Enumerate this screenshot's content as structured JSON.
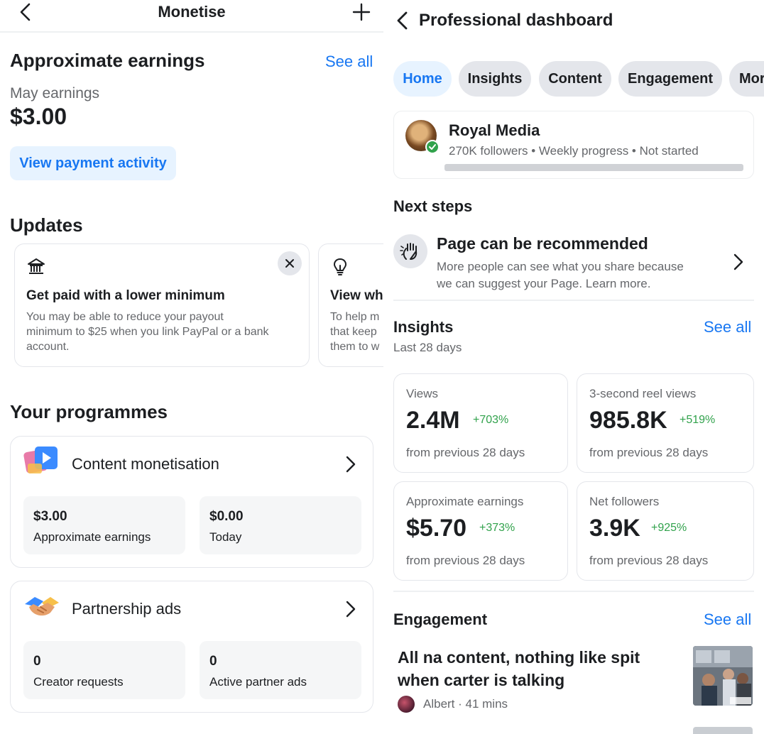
{
  "left": {
    "header": {
      "title": "Monetise"
    },
    "earnings": {
      "title": "Approximate earnings",
      "see_all": "See all",
      "period_label": "May earnings",
      "amount": "$3.00",
      "button": "View payment activity"
    },
    "updates": {
      "title": "Updates",
      "cards": [
        {
          "icon": "bank-icon",
          "title": "Get paid with a lower minimum",
          "body": "You may be able to reduce your payout\nminimum to $25 when you link PayPal or a bank\naccount."
        },
        {
          "icon": "lightbulb-icon",
          "title": "View wh",
          "body": "To help m\nthat keep\nthem to w"
        }
      ]
    },
    "programmes": {
      "title": "Your programmes",
      "items": [
        {
          "title": "Content monetisation",
          "stats": [
            {
              "value": "$3.00",
              "label": "Approximate earnings"
            },
            {
              "value": "$0.00",
              "label": "Today"
            }
          ]
        },
        {
          "title": "Partnership ads",
          "stats": [
            {
              "value": "0",
              "label": "Creator requests"
            },
            {
              "value": "0",
              "label": "Active partner ads"
            }
          ]
        }
      ]
    }
  },
  "right": {
    "header": {
      "title": "Professional dashboard"
    },
    "tabs": [
      "Home",
      "Insights",
      "Content",
      "Engagement",
      "Mor"
    ],
    "profile": {
      "name": "Royal Media",
      "meta": "270K followers • Weekly progress • Not started"
    },
    "next_steps": {
      "title": "Next steps",
      "item_title": "Page can be recommended",
      "item_body": "More people can see what you share because\nwe can suggest your Page. Learn more."
    },
    "insights": {
      "title": "Insights",
      "see_all": "See all",
      "period": "Last 28 days",
      "metrics": [
        {
          "label": "Views",
          "value": "2.4M",
          "change": "+703%",
          "sub": "from previous 28 days"
        },
        {
          "label": "3-second reel views",
          "value": "985.8K",
          "change": "+519%",
          "sub": "from previous 28 days"
        },
        {
          "label": "Approximate earnings",
          "value": "$5.70",
          "change": "+373%",
          "sub": "from previous 28 days"
        },
        {
          "label": "Net followers",
          "value": "3.9K",
          "change": "+925%",
          "sub": "from previous 28 days"
        }
      ]
    },
    "engagement": {
      "title": "Engagement",
      "see_all": "See all",
      "post_title": "All na content, nothing like spit when carter is talking",
      "post_meta": "Albert · 41 mins"
    }
  },
  "colors": {
    "accent": "#1877f2",
    "accent_bg": "#e7f3ff",
    "positive": "#31a24c",
    "muted": "#65676b"
  }
}
